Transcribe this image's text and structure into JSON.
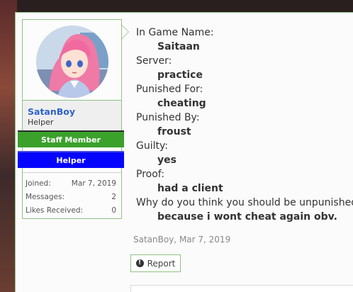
{
  "user": {
    "name": "SatanBoy",
    "title": "Helper",
    "banners": [
      "Staff Member",
      "Helper"
    ],
    "stats": [
      {
        "label": "Joined:",
        "value": "Mar 7, 2019"
      },
      {
        "label": "Messages:",
        "value": "2"
      },
      {
        "label": "Likes Received:",
        "value": "0"
      }
    ]
  },
  "message": {
    "lines": [
      {
        "q": "In Game Name:",
        "a": "Saitaan"
      },
      {
        "q": "Server:",
        "a": "practice"
      },
      {
        "q": "Punished For:",
        "a": "cheating"
      },
      {
        "q": "Punished By:",
        "a": "froust"
      },
      {
        "q": "Guilty:",
        "a": "yes"
      },
      {
        "q": "Proof:",
        "a": "had a client"
      },
      {
        "q": "Why do you think you should be unpunished",
        "a": "because i wont cheat again obv."
      }
    ]
  },
  "meta": {
    "attribution": "SatanBoy, Mar 7, 2019"
  },
  "actions": {
    "report_label": "Report",
    "report_icon": "!"
  },
  "colors": {
    "frame_border": "#8fc283",
    "username": "#2f62c9",
    "staff_banner": "#3aa12b",
    "helper_banner": "#0505ff"
  }
}
